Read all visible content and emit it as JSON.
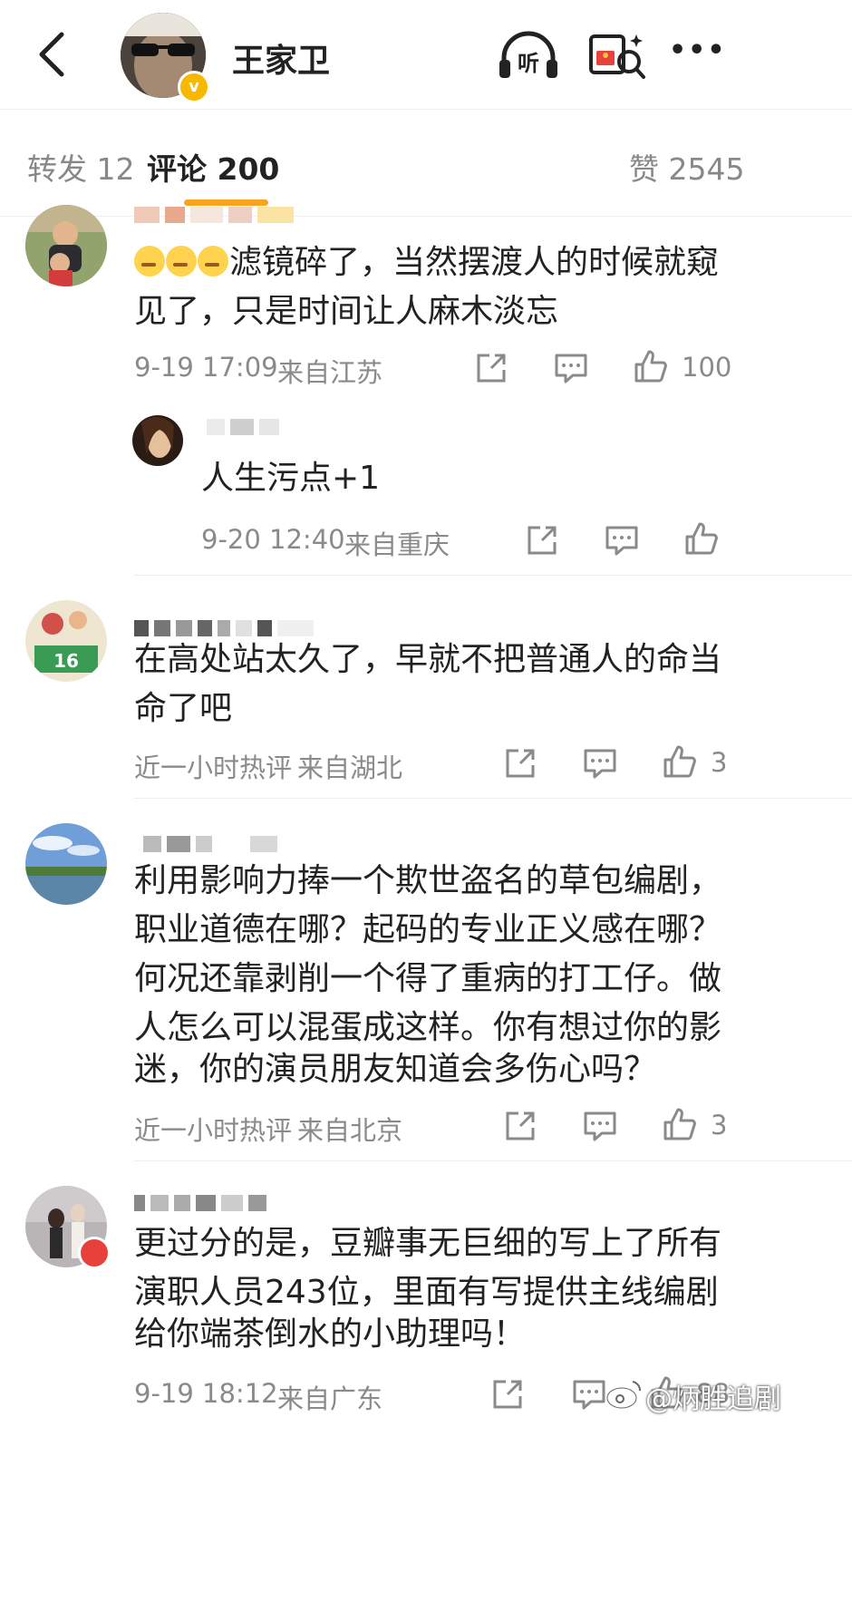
{
  "header": {
    "title": "王家卫",
    "verified_badge": "v",
    "listen_label": "听",
    "more_label": "•••",
    "icons": [
      "back-icon",
      "listen-headphone-icon",
      "red-packet-search-icon",
      "more-icon"
    ]
  },
  "tabs": {
    "repost": "转发 12",
    "comments": "评论 200",
    "likes": "赞 2545"
  },
  "comments": [
    {
      "text_line1": "滤镜碎了，当然摆渡人的时候就窥",
      "text_line2": "见了，只是时间让人麻木淡忘",
      "time": "9-19 17:09",
      "location": "来自江苏",
      "likes": "100",
      "reply": {
        "text": "人生污点+1",
        "time": "9-20 12:40",
        "location": "来自重庆"
      }
    },
    {
      "text_line1": "在高处站太久了，早就不把普通人的命当",
      "text_line2": "命了吧",
      "time": "近一小时热评",
      "location": "来自湖北",
      "likes": "3"
    },
    {
      "text_line1": "利用影响力捧一个欺世盗名的草包编剧，",
      "text_line2": "职业道德在哪？起码的专业正义感在哪？",
      "text_line3": "何况还靠剥削一个得了重病的打工仔。做",
      "text_line4": "人怎么可以混蛋成这样。你有想过你的影",
      "text_line5": "迷，你的演员朋友知道会多伤心吗？",
      "time": "近一小时热评",
      "location": "来自北京",
      "likes": "3"
    },
    {
      "text_line1": "更过分的是，豆瓣事无巨细的写上了所有",
      "text_line2": "演职人员243位，里面有写提供主线编剧",
      "text_line3": "给你端茶倒水的小助理吗！",
      "time": "9-19 18:12",
      "location": "来自广东",
      "likes": "88"
    }
  ],
  "watermark": "@炳胜追剧",
  "colors": {
    "accent": "#f7a51e",
    "meta_gray": "#8a8a8a",
    "text": "#222222",
    "verified": "#f6b800"
  }
}
